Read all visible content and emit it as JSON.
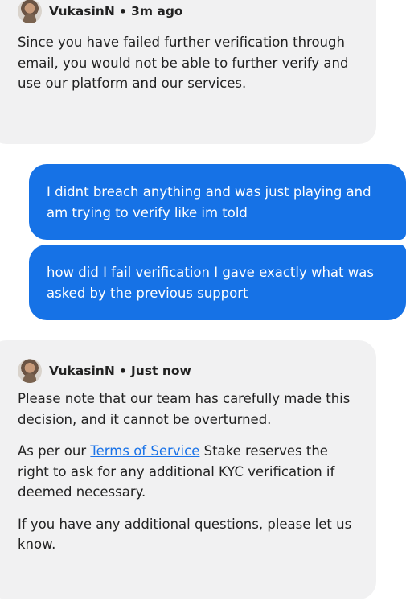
{
  "messages": [
    {
      "type": "incoming",
      "sender": "VukasinN",
      "separator": "•",
      "time": "3m ago",
      "paragraphs": [
        "Since you have failed further verification through email, you would not be able to further verify and use our platform and our services."
      ]
    },
    {
      "type": "outgoing",
      "text": "I didnt breach anything and was just playing and am trying to verify like im told"
    },
    {
      "type": "outgoing",
      "text": "how did I fail verification I gave exactly what was asked by the previous support"
    },
    {
      "type": "incoming",
      "sender": "VukasinN",
      "separator": "•",
      "time": "Just now",
      "paragraphs": [
        "Please note that our team has carefully made this decision, and it cannot be overturned.",
        {
          "before": "As per our",
          "link": "Terms of Service",
          "after": "Stake reserves the right to ask for any additional KYC verification if deemed necessary."
        },
        "If you have any additional questions, please let us know."
      ]
    }
  ],
  "colors": {
    "incoming_bg": "#f1f1f2",
    "outgoing_bg": "#1672e6",
    "link": "#1a73e8"
  },
  "icons": {
    "avatar": "agent-avatar"
  }
}
